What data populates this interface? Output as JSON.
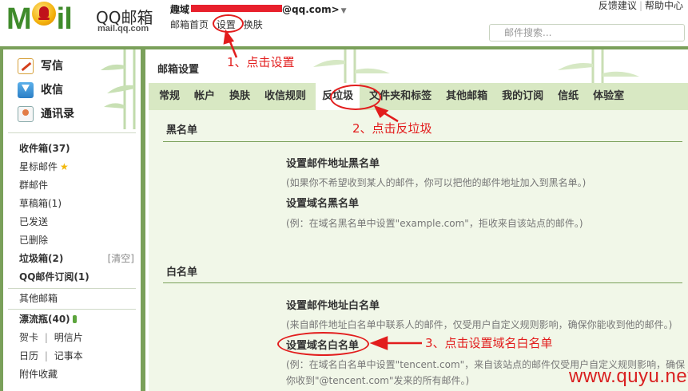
{
  "logo": {
    "moil_left": "M",
    "moil_right": "il",
    "product": "QQ邮箱",
    "domain": "mail.qq.com"
  },
  "header": {
    "user_prefix": "趣域",
    "user_suffix": "@qq.com>",
    "dropdown_glyph": "▼",
    "nav": [
      "邮箱首页",
      "设置",
      "换肤"
    ],
    "links": [
      "反馈建议",
      "帮助中心"
    ],
    "search_placeholder": "邮件搜索..."
  },
  "sidebar": {
    "compose": [
      "写信",
      "收信",
      "通讯录"
    ],
    "folders": {
      "inbox": "收件箱(37)",
      "starred": "星标邮件",
      "group": "群邮件",
      "drafts": "草稿箱(1)",
      "sent": "已发送",
      "deleted": "已删除",
      "spam": "垃圾箱(2)",
      "spam_clear": "[清空]",
      "subscriptions": "QQ邮件订阅(1)",
      "other": "其他邮箱",
      "bottle": "漂流瓶(40)",
      "card": "贺卡",
      "postcard": "明信片",
      "calendar": "日历",
      "notes": "记事本",
      "attachments": "附件收藏",
      "sep": "|"
    }
  },
  "main": {
    "title": "邮箱设置",
    "tabs": [
      "常规",
      "帐户",
      "换肤",
      "收信规则",
      "反垃圾",
      "文件夹和标签",
      "其他邮箱",
      "我的订阅",
      "信纸",
      "体验室"
    ],
    "blacklist": {
      "heading": "黑名单",
      "address_title": "设置邮件地址黑名单",
      "address_desc": "(如果你不希望收到某人的邮件，你可以把他的邮件地址加入到黑名单。)",
      "domain_title": "设置域名黑名单",
      "domain_desc": "(例：在域名黑名单中设置\"example.com\"，拒收来自该站点的邮件。)"
    },
    "whitelist": {
      "heading": "白名单",
      "address_title": "设置邮件地址白名单",
      "address_desc": "(来自邮件地址白名单中联系人的邮件，仅受用户自定义规则影响，确保你能收到他的邮件。)",
      "domain_title": "设置域名白名单",
      "domain_desc_line1": "(例：在域名白名单中设置\"tencent.com\"，来自该站点的邮件仅受用户自定义规则影响，确保",
      "domain_desc_line2": "你收到\"@tencent.com\"发来的所有邮件。)"
    }
  },
  "annotations": {
    "step1": "1、点击设置",
    "step2": "2、点击反垃圾",
    "step3": "3、点击设置域名白名单",
    "color": "#e21d1d"
  },
  "watermark": "www.quyu.net",
  "colors": {
    "frame": "#7aa05a",
    "tabbar": "#d8e8c3",
    "content": "#f1f7e8",
    "logo_green": "#3f8b2b"
  }
}
